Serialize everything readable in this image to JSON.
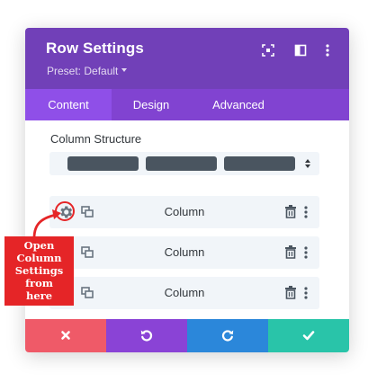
{
  "modal": {
    "title": "Row Settings",
    "preset_label": "Preset: Default",
    "header_icons": [
      "resize-icon",
      "sidebar-layout-icon",
      "more-vertical-icon"
    ],
    "colors": {
      "header": "#7140b8",
      "tabs": "#8143d1",
      "active_tab": "#8f4fe8"
    }
  },
  "tabs": [
    {
      "label": "Content",
      "active": true
    },
    {
      "label": "Design",
      "active": false
    },
    {
      "label": "Advanced",
      "active": false
    }
  ],
  "content": {
    "section_title": "Column Structure",
    "structure_columns": 3,
    "columns": [
      {
        "label": "Column",
        "icons": [
          "gear-icon",
          "duplicate-icon",
          "trash-icon",
          "more-vertical-icon"
        ]
      },
      {
        "label": "Column",
        "icons": [
          "gear-icon",
          "duplicate-icon",
          "trash-icon",
          "more-vertical-icon"
        ]
      },
      {
        "label": "Column",
        "icons": [
          "gear-icon",
          "duplicate-icon",
          "trash-icon",
          "more-vertical-icon"
        ]
      }
    ]
  },
  "footer": {
    "buttons": [
      {
        "name": "cancel",
        "icon": "close-icon",
        "color": "#ef5a68"
      },
      {
        "name": "undo",
        "icon": "undo-icon",
        "color": "#8a43d6"
      },
      {
        "name": "redo",
        "icon": "redo-icon",
        "color": "#2b87da"
      },
      {
        "name": "save",
        "icon": "check-icon",
        "color": "#29c4a9"
      }
    ]
  },
  "annotation": {
    "text": "Open\nColumn\nSettings\nfrom\nhere",
    "color": "#e52527"
  }
}
